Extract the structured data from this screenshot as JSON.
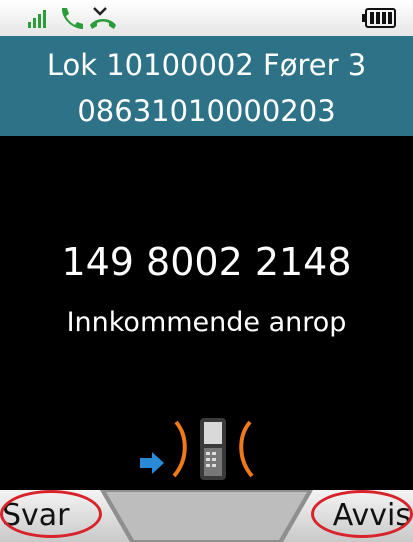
{
  "status_bar": {
    "icons": [
      "signal-icon",
      "phone-icon",
      "missed-call-icon",
      "battery-icon"
    ]
  },
  "header": {
    "line1": "Lok 10100002 Fører 3",
    "line2": "08631010000203"
  },
  "call": {
    "number": "149 8002 2148",
    "status": "Innkommende anrop"
  },
  "softkeys": {
    "left_label": "Svar",
    "right_label": "Avvis"
  },
  "colors": {
    "header_bg": "#2e7287",
    "highlight": "#d8232a",
    "ring_accent": "#f07a1a",
    "arrow": "#2a8ad8"
  }
}
